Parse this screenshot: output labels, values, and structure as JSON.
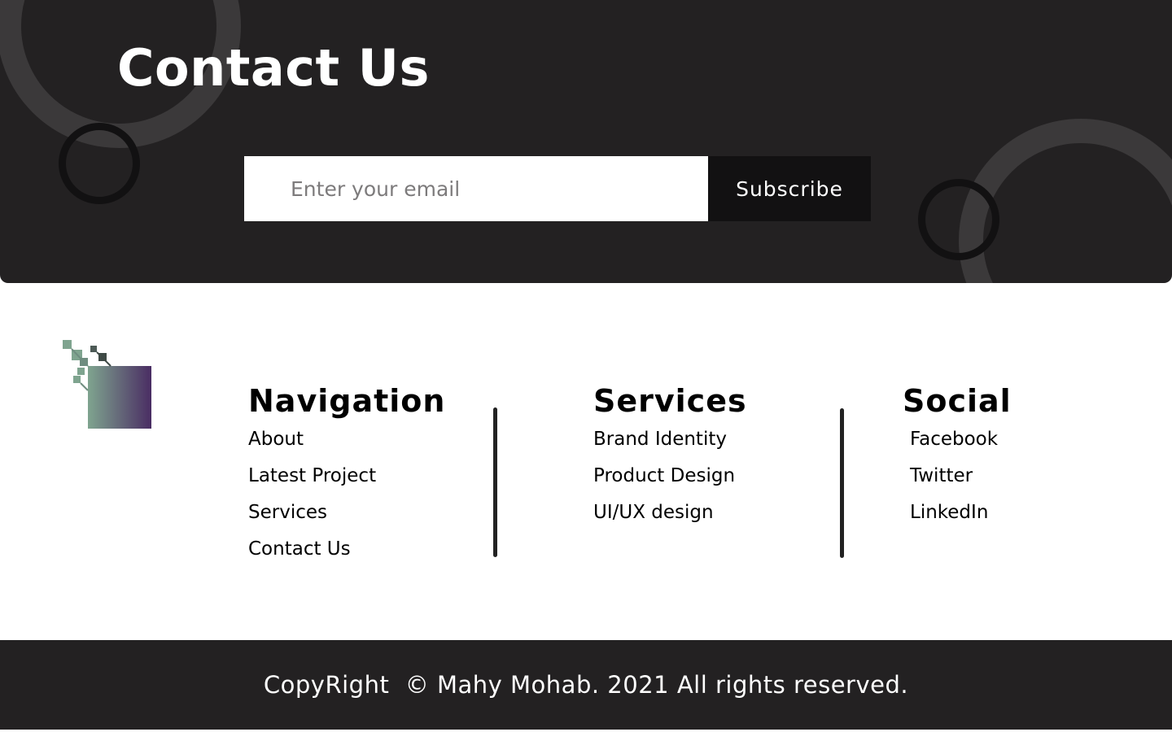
{
  "contact": {
    "title": "Contact Us",
    "email_placeholder": "Enter your email",
    "subscribe_label": "Subscribe"
  },
  "logo": {
    "colors": [
      "#7fa48f",
      "#4a2d63"
    ]
  },
  "footer": {
    "navigation": {
      "heading": "Navigation",
      "links": [
        "About",
        "Latest Project",
        "Services",
        "Contact Us"
      ]
    },
    "services": {
      "heading": "Services",
      "links": [
        "Brand Identity",
        "Product Design",
        "UI/UX design"
      ]
    },
    "social": {
      "heading": "Social",
      "links": [
        "Facebook",
        "Twitter",
        "LinkedIn"
      ]
    }
  },
  "copyright": {
    "text": "CopyRight  © Mahy Mohab. 2021 All rights reserved."
  },
  "colors": {
    "dark_bg": "#232122",
    "ring_light": "#3b393a",
    "ring_dark": "#121112",
    "button_bg": "#121112",
    "text_dark": "#000000",
    "text_light": "#ffffff"
  }
}
